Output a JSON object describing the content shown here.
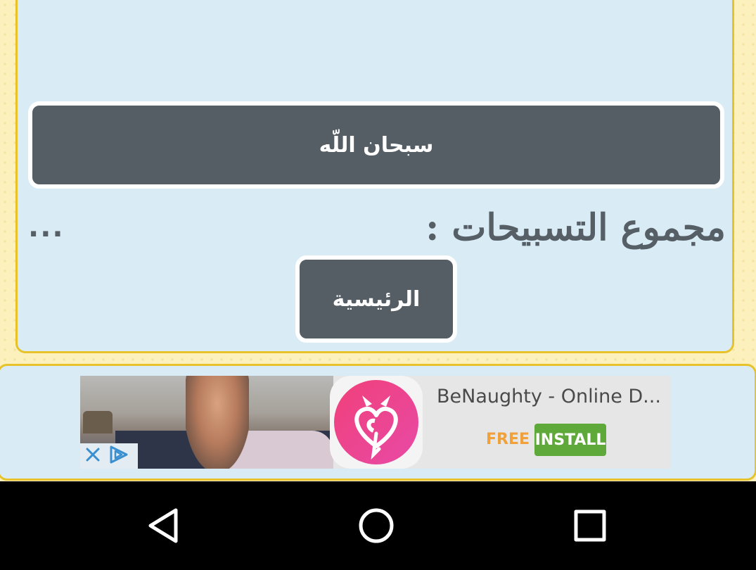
{
  "main": {
    "tasbih_button_label": "سبحان اللّه",
    "count_label": "مجموع التسبيحات :",
    "count_value": "...",
    "home_button_label": "الرئيسية"
  },
  "ad": {
    "title": "BeNaughty - Online D...",
    "free_label": "FREE",
    "install_label": "INSTALL",
    "icon": "heart-devil-icon",
    "colors": {
      "install": "#5fa93a",
      "free": "#f0a13a",
      "icon_gradient_start": "#f0407a",
      "icon_gradient_end": "#e84aa6"
    }
  },
  "nav": {
    "back_icon": "back-triangle-icon",
    "home_icon": "home-circle-icon",
    "recents_icon": "recents-square-icon"
  },
  "colors": {
    "button_bg": "#555d65",
    "panel_bg": "#d9ecf6",
    "panel_border": "#e7c22a",
    "page_bg": "#fcf1bd"
  }
}
